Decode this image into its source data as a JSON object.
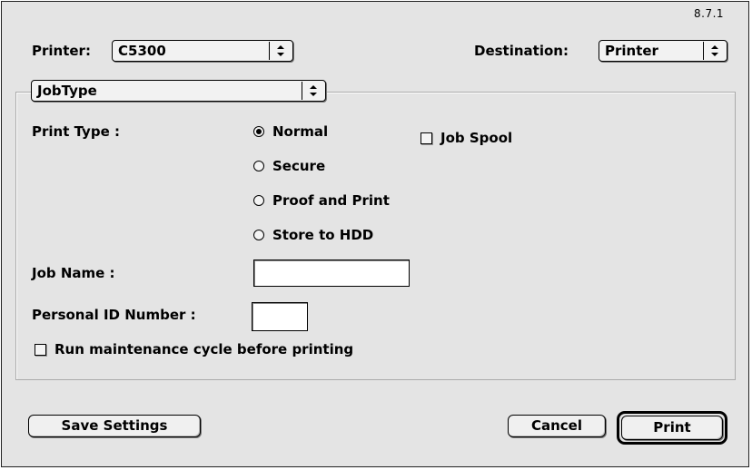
{
  "dialog": {
    "version": "8.7.1",
    "printer": {
      "label": "Printer:",
      "value": "C5300"
    },
    "destination": {
      "label": "Destination:",
      "value": "Printer"
    },
    "panel_selector": {
      "value": "JobType"
    }
  },
  "job_type": {
    "print_type_label": "Print Type :",
    "options": [
      {
        "label": "Normal",
        "selected": true
      },
      {
        "label": "Secure",
        "selected": false
      },
      {
        "label": "Proof and Print",
        "selected": false
      },
      {
        "label": "Store to HDD",
        "selected": false
      }
    ],
    "job_spool": {
      "label": "Job Spool",
      "checked": false
    },
    "job_name": {
      "label": "Job Name :",
      "value": ""
    },
    "pin": {
      "label": "Personal ID Number :",
      "value": ""
    },
    "maintenance": {
      "label": "Run maintenance cycle before printing",
      "checked": false
    }
  },
  "buttons": {
    "save_settings": "Save Settings",
    "cancel": "Cancel",
    "print": "Print"
  }
}
